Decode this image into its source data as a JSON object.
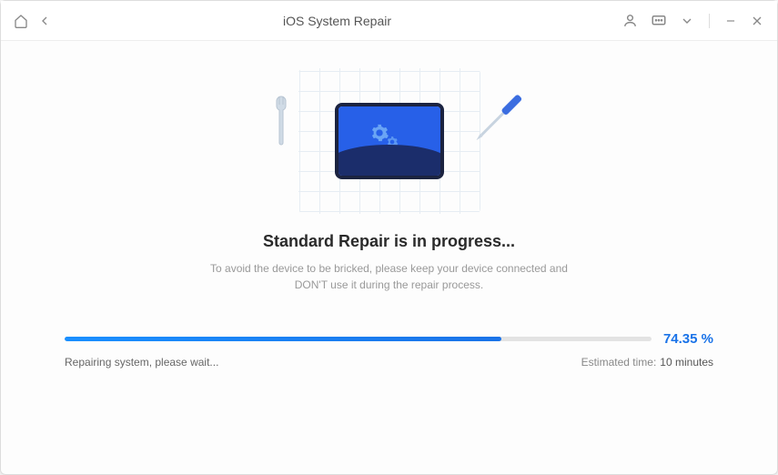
{
  "titlebar": {
    "title": "iOS System Repair"
  },
  "main": {
    "heading": "Standard Repair is in progress...",
    "subtext": "To avoid the device to be bricked, please keep your device connected and DON'T use it during the repair process."
  },
  "progress": {
    "percent": 74.35,
    "percent_display": "74.35 %",
    "status": "Repairing system, please wait...",
    "eta_label": "Estimated time:",
    "eta_value": "10 minutes"
  },
  "colors": {
    "accent": "#1a73e8"
  }
}
